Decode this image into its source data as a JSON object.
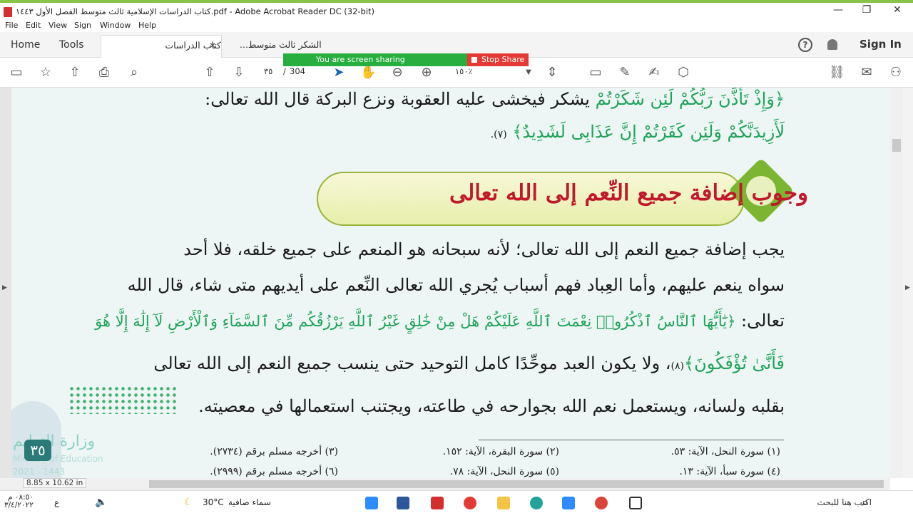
{
  "window": {
    "title": "كتاب الدراسات الإسلامية ثالث متوسط الفصل الأول ١٤٤٣.pdf - Adobe Acrobat Reader DC (32-bit)",
    "minimize": "—",
    "maximize": "❐",
    "close": "✕"
  },
  "menu": {
    "items": [
      "File",
      "Edit",
      "View",
      "Sign",
      "Window",
      "Help"
    ]
  },
  "tabs": {
    "home": "Home",
    "tools": "Tools",
    "doc_active": "كتاب الدراسات الإس...",
    "doc_other": "الشكر ثالث متوسط...",
    "close": "✕",
    "help": "?",
    "sign_in": "Sign In"
  },
  "toolbar": {
    "page_current": "٣٥",
    "page_sep": "/",
    "page_total": "304",
    "zoom": "١٥٠٪"
  },
  "share": {
    "text": "You are screen sharing",
    "stop": "Stop Share"
  },
  "document": {
    "line1": "يشكر فيخشى عليه العقوبة ونزع البركة قال الله تعالى:",
    "line1_quran": "﴿وَإِذْ تَأَذَّنَ رَبُّكُمْ لَئِن شَكَرْتُمْ",
    "line2_quran": "لَأَزِيدَنَّكُمْ وَلَئِن كَفَرْتُمْ إِنَّ عَذَابِى لَشَدِيدٌ﴾",
    "line2_ref": "(٧).",
    "heading": "وجوب إضافة جميع النِّعم إلى الله تعالى",
    "p1": "يجب إضافة جميع النعم إلى الله تعالى؛ لأنه سبحانه هو المنعم على جميع خلقه، فلا أحد",
    "p2": "سواه ينعم عليهم، وأما العِباد فهم أسباب يُجري الله تعالى النِّعم على أيديهم متى شاء، قال الله",
    "p3_start": "تعالى:",
    "p3_quran": "﴿يَٰٓأَيُّهَا ٱلنَّاسُ ٱذْكُرُوا۟ نِعْمَتَ ٱللَّهِ عَلَيْكُمْ هَلْ مِنْ خَٰلِقٍ غَيْرُ ٱللَّهِ يَرْزُقُكُم مِّنَ ٱلسَّمَآءِ وَٱلْأَرْضِ لَآ إِلَٰهَ إِلَّا هُوَ",
    "p4_quran": "فَأَنَّىٰ تُؤْفَكُونَ﴾",
    "p4_ref": "(٨)",
    "p4_rest": "، ولا يكون العبد موحِّدًا كامل التوحيد حتى ينسب جميع النعم إلى الله تعالى",
    "p5": "بقلبه ولسانه، ويستعمل نعم الله بجوارحه في طاعته، ويجتنب استعمالها في معصيته.",
    "footnotes": [
      "(١) سورة النحل، الآية: ٥٣.",
      "(٢) سورة البقرة، الآية: ١٥٢.",
      "(٣) أخرجه مسلم برقم (٢٧٣٤).",
      "(٤) سورة سبأ، الآية: ١٣.",
      "(٥) سورة النحل، الآية: ٧٨.",
      "(٦) أخرجه مسلم برقم (٢٩٩٩)."
    ],
    "page_number": "٣٥",
    "watermark_ar": "وزارة التعليم",
    "watermark_en": "Ministry of Education",
    "watermark_year": "2021 - 1443"
  },
  "status": {
    "page_size": "8.85 x 10.62 in"
  },
  "taskbar": {
    "search": "اكتب هنا للبحث",
    "weather_desc": "سماء صافية",
    "temp": "30°C",
    "time": "٠٨:٥٠ م",
    "date": "٣/٤/٢٠٢٢",
    "lang": "ع"
  }
}
